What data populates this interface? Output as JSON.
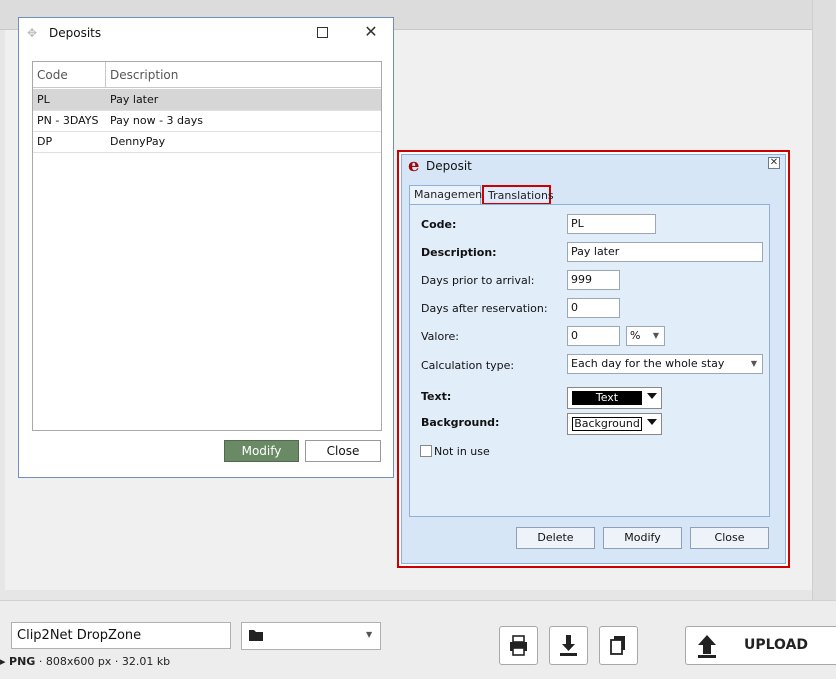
{
  "deposits_window": {
    "title": "Deposits",
    "columns": [
      "Code",
      "Description"
    ],
    "rows": [
      {
        "code": "PL",
        "description": "Pay later",
        "selected": true
      },
      {
        "code": "PN - 3DAYS",
        "description": "Pay now - 3 days",
        "selected": false
      },
      {
        "code": "DP",
        "description": "DennyPay",
        "selected": false
      }
    ],
    "modify_label": "Modify",
    "close_label": "Close"
  },
  "deposit_dialog": {
    "logo": "e",
    "title": "Deposit",
    "tabs": [
      {
        "label": "Management",
        "active": true
      },
      {
        "label": "Translations",
        "active": false
      }
    ],
    "fields": {
      "code_label": "Code:",
      "code_value": "PL",
      "description_label": "Description:",
      "description_value": "Pay later",
      "days_prior_label": "Days prior to arrival:",
      "days_prior_value": "999",
      "days_after_label": "Days after reservation:",
      "days_after_value": "0",
      "valore_label": "Valore:",
      "valore_value": "0",
      "valore_unit": "%",
      "calc_type_label": "Calculation type:",
      "calc_type_value": "Each day for the whole stay",
      "text_label": "Text:",
      "text_value": "Text",
      "background_label": "Background:",
      "background_value": "Background",
      "not_in_use_label": "Not in use"
    },
    "buttons": {
      "delete": "Delete",
      "modify": "Modify",
      "close": "Close"
    }
  },
  "bottom_bar": {
    "dropzone_value": "Clip2Net DropZone",
    "format": "PNG",
    "dimensions": "808x600 px",
    "size": "32.01 kb",
    "upload_label": "UPLOAD"
  },
  "colors": {
    "accent_red": "#cc0000",
    "modify_green": "#6a8a65",
    "dialog_blue": "#d7e6f7"
  }
}
